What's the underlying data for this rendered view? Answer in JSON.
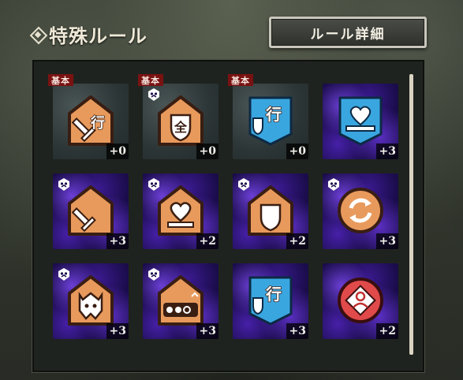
{
  "header": {
    "title": "特殊ルール",
    "detail_button": "ルール詳細"
  },
  "cards": [
    {
      "name": "card-1",
      "bg": "grey",
      "icon": "orange-house-sword-icon",
      "glyph": "行",
      "bonus": "+0",
      "basic": "基本"
    },
    {
      "name": "card-2",
      "bg": "grey",
      "icon": "orange-house-shield-icon",
      "glyph": "全",
      "bonus": "+0",
      "basic": "基本"
    },
    {
      "name": "card-3",
      "bg": "grey",
      "icon": "blue-shield-move-icon",
      "glyph": "行",
      "bonus": "+0",
      "basic": "基本"
    },
    {
      "name": "card-4",
      "bg": "purple",
      "icon": "blue-heart-hand-icon",
      "glyph": "",
      "bonus": "+3",
      "basic": ""
    },
    {
      "name": "card-5",
      "bg": "purple",
      "icon": "orange-house-sword-icon",
      "glyph": "",
      "bonus": "+3",
      "basic": ""
    },
    {
      "name": "card-6",
      "bg": "purple",
      "icon": "orange-house-heart-icon",
      "glyph": "",
      "bonus": "+2",
      "basic": ""
    },
    {
      "name": "card-7",
      "bg": "purple",
      "icon": "orange-house-shield-icon",
      "glyph": "",
      "bonus": "+2",
      "basic": ""
    },
    {
      "name": "card-8",
      "bg": "purple",
      "icon": "orange-circle-refresh-icon",
      "glyph": "",
      "bonus": "+3",
      "basic": ""
    },
    {
      "name": "card-9",
      "bg": "purple",
      "icon": "orange-house-beast-icon",
      "glyph": "",
      "bonus": "+3",
      "basic": ""
    },
    {
      "name": "card-10",
      "bg": "purple",
      "icon": "orange-house-dots-icon",
      "glyph": "",
      "bonus": "+3",
      "basic": ""
    },
    {
      "name": "card-11",
      "bg": "purple",
      "icon": "blue-shield-move-icon",
      "glyph": "行",
      "bonus": "+3",
      "basic": ""
    },
    {
      "name": "card-12",
      "bg": "purple",
      "icon": "red-diamond-person-icon",
      "glyph": "",
      "bonus": "+2",
      "basic": ""
    }
  ]
}
